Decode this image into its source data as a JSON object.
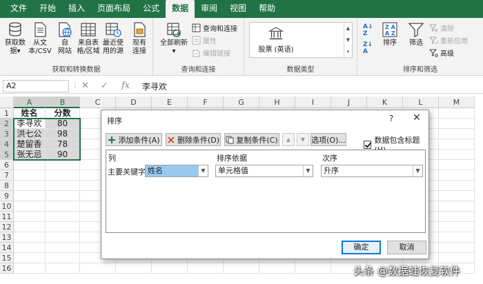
{
  "menu": {
    "tabs": [
      "文件",
      "开始",
      "插入",
      "页面布局",
      "公式",
      "数据",
      "审阅",
      "视图",
      "帮助"
    ],
    "active_index": 5
  },
  "ribbon": {
    "groups": {
      "get_data": {
        "label": "获取和转换数据",
        "buttons": [
          {
            "label": "获取数\n据▾",
            "icon": "database-icon"
          },
          {
            "label": "从文\n本/CSV",
            "icon": "text-file-icon"
          },
          {
            "label": "自\n网站",
            "icon": "web-icon"
          },
          {
            "label": "来自表\n格/区域",
            "icon": "table-icon"
          },
          {
            "label": "最近使\n用的源",
            "icon": "recent-source-icon"
          },
          {
            "label": "现有\n连接",
            "icon": "existing-connection-icon"
          }
        ]
      },
      "queries": {
        "label": "查询和连接",
        "refresh_label": "全部刷新",
        "refresh_dropdown": "▾",
        "items": [
          {
            "label": "查询和连接",
            "disabled": false
          },
          {
            "label": "属性",
            "disabled": true
          },
          {
            "label": "编辑链接",
            "disabled": true
          }
        ]
      },
      "data_types": {
        "label": "数据类型",
        "item_label": "股票 (英语)"
      },
      "sort_filter": {
        "label": "排序和筛选",
        "sort_label": "排序",
        "filter_label": "筛选",
        "items": [
          {
            "label": "清除",
            "disabled": true
          },
          {
            "label": "重新应用",
            "disabled": true
          },
          {
            "label": "高级",
            "disabled": false
          }
        ]
      }
    }
  },
  "formula_bar": {
    "name_box": "A2",
    "fx": "fx",
    "value": "李寻欢"
  },
  "sheet": {
    "columns": [
      "A",
      "B",
      "C",
      "D",
      "E",
      "F",
      "G",
      "H",
      "I",
      "J",
      "K",
      "L",
      "M"
    ],
    "rows": [
      "1",
      "2",
      "3",
      "4",
      "5",
      "6",
      "7",
      "8",
      "9",
      "10",
      "11",
      "12",
      "13",
      "14",
      "15",
      "16"
    ],
    "headers": [
      "姓名",
      "分数"
    ],
    "data": [
      [
        "李寻欢",
        "80"
      ],
      [
        "洪七公",
        "98"
      ],
      [
        "楚留香",
        "78"
      ],
      [
        "张无忌",
        "90"
      ]
    ]
  },
  "dialog": {
    "title": "排序",
    "help": "?",
    "close": "✕",
    "add_condition": "添加条件(A)",
    "delete_condition": "删除条件(D)",
    "copy_condition": "复制条件(C)",
    "move_up": "▲",
    "move_down": "▼",
    "options": "选项(O)...",
    "has_headers": "数据包含标题(H)",
    "col_header": "列",
    "sort_on_header": "排序依据",
    "order_header": "次序",
    "row_label": "主要关键字",
    "column_value": "姓名",
    "sort_on_value": "单元格值",
    "order_value": "升序",
    "ok": "确定",
    "cancel": "取消"
  },
  "watermark": "头条 @数据蛙恢复软件",
  "colors": {
    "excel_green": "#217346",
    "selection_fill": "#d9d9d9",
    "highlight_blue": "#99c9ef"
  }
}
